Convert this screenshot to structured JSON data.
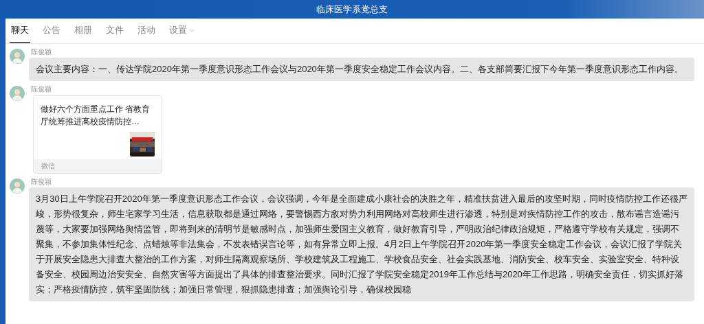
{
  "window": {
    "title": "临床医学系党总支"
  },
  "tabs": [
    {
      "label": "聊天",
      "selected": true
    },
    {
      "label": "公告",
      "selected": false
    },
    {
      "label": "相册",
      "selected": false
    },
    {
      "label": "文件",
      "selected": false
    },
    {
      "label": "活动",
      "selected": false
    },
    {
      "label": "设置",
      "selected": false,
      "dropdown": true
    }
  ],
  "messages": [
    {
      "kind": "text",
      "sender": "陈俊颖",
      "text": "会议主要内容：一、传达学院2020年第一季度意识形态工作会议与2020年第一季度安全稳定工作会议内容。二、各支部简要汇报下今年第一季度意识形态工作内容。"
    },
    {
      "kind": "link",
      "sender": "陈俊颖",
      "title": "做好六个方面重点工作 省教育厅统筹推进高校疫情防控…",
      "source": "微信"
    },
    {
      "kind": "text",
      "sender": "陈俊颖",
      "text": "3月30日上午学院召开2020年第一季度意识形态工作会议，会议强调，今年是全面建成小康社会的决胜之年，精准扶贫进入最后的攻坚时期，同时疫情防控工作还很严峻，形势很复杂，师生宅家学习生活，信息获取都是通过网络，要警惕西方敌对势力利用网络对高校师生进行渗透，特别是对疾情防控工作的攻击，散布谣言造谣污蔑等，大家要加强网络舆情监管，即将到来的清明节是敏感时点，加强师生爱国主义教育，做好教育引导，严明政治纪律政治规矩，严格遵守学校有关规定，强调不聚集，不参加集体性纪念、点蜡烛等非法集会，不发表错误言论等，如有异常立即上报。4月2日上午学院召开2020年第一季度安全稳定工作会议，会议汇报了学院关于开展安全隐患大排查大整治的工作方案，对师生隔离观察场所、学校建筑及工程施工、学校食品安全、社会实践基地、消防安全、校车安全、实验室安全、特种设备安全、校园周边治安安全、自然灾害等方面提出了具体的排查整治要求。同时汇报了学院安全稳定2019年工作总结与2020年工作思路，明确安全责任，切实抓好落实；严格疫情防控，筑牢坚固防线；加强日常管理，狠抓隐患排查；加强舆论引导，确保校园稳"
    }
  ]
}
